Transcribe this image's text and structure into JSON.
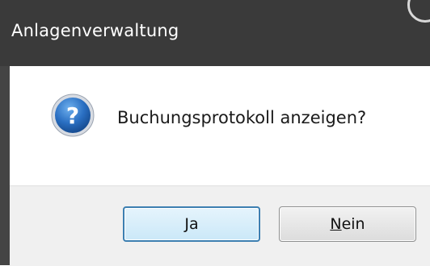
{
  "dialog": {
    "title": "Anlagenverwaltung",
    "icon": "question-icon",
    "message": "Buchungsprotokoll anzeigen?",
    "buttons": {
      "yes_label": "Ja",
      "no_mnemonic": "N",
      "no_rest": "ein"
    }
  },
  "colors": {
    "titlebar": "#3a3a3a",
    "content_bg": "#ffffff",
    "footer_bg": "#f0f0f0",
    "default_button_border": "#3c7fb1",
    "icon_blue": "#1f5fa8"
  }
}
